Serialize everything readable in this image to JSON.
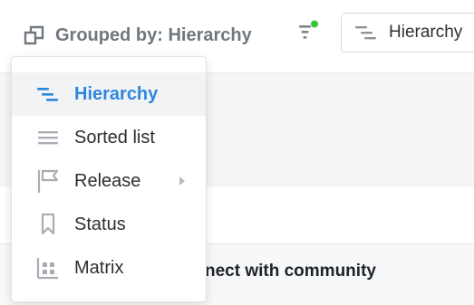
{
  "toolbar": {
    "grouped_by": {
      "label": "Grouped by: Hierarchy",
      "icon": "group-by-icon"
    },
    "filter": {
      "icon": "filter-icon",
      "active_dot_color": "#3bc13b"
    },
    "view_select": {
      "label": "Hierarchy",
      "icon": "hierarchy-icon"
    }
  },
  "group_menu": {
    "items": [
      {
        "label": "Hierarchy",
        "icon": "hierarchy-icon",
        "selected": true,
        "has_submenu": false
      },
      {
        "label": "Sorted list",
        "icon": "sorted-list-icon",
        "selected": false,
        "has_submenu": false
      },
      {
        "label": "Release",
        "icon": "release-flag-icon",
        "selected": false,
        "has_submenu": true
      },
      {
        "label": "Status",
        "icon": "status-bookmark-icon",
        "selected": false,
        "has_submenu": false
      },
      {
        "label": "Matrix",
        "icon": "matrix-icon",
        "selected": false,
        "has_submenu": false
      }
    ]
  },
  "content": {
    "row_title": "nect with community"
  },
  "colors": {
    "accent": "#2e86de",
    "muted_text": "#6f7780",
    "text": "#2b2f33",
    "menu_hover": "#f2f3f4"
  }
}
